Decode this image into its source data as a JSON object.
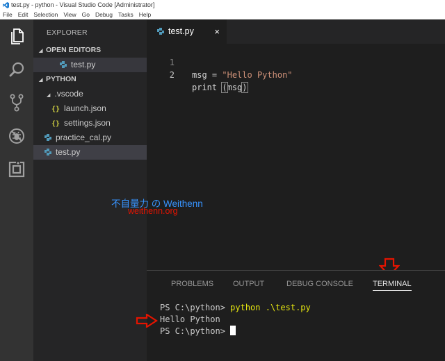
{
  "window": {
    "title": "test.py - python - Visual Studio Code [Administrator]"
  },
  "menu": [
    "File",
    "Edit",
    "Selection",
    "View",
    "Go",
    "Debug",
    "Tasks",
    "Help"
  ],
  "activity_bar": {
    "icons": [
      "files-icon",
      "search-icon",
      "source-control-icon",
      "debug-icon",
      "extensions-icon"
    ]
  },
  "sidebar": {
    "title": "EXPLORER",
    "open_editors": {
      "header": "OPEN EDITORS",
      "items": [
        {
          "label": "test.py"
        }
      ]
    },
    "folder": {
      "header": "PYTHON",
      "vscode": ".vscode",
      "launch": "launch.json",
      "settings": "settings.json",
      "practice": "practice_cal.py",
      "test": "test.py"
    }
  },
  "editor": {
    "tab_label": "test.py",
    "close_glyph": "×",
    "lines": [
      {
        "num": "1",
        "var": "msg",
        "op": " = ",
        "str": "\"Hello Python\""
      },
      {
        "num": "2",
        "fn": "print",
        "sp": " ",
        "lp": "(",
        "arg": "msg",
        "rp": ")"
      }
    ]
  },
  "watermark": {
    "line1": "不自量力 の Weithenn",
    "line2": "weithenn.org"
  },
  "panel": {
    "tabs": [
      "PROBLEMS",
      "OUTPUT",
      "DEBUG CONSOLE",
      "TERMINAL"
    ],
    "active_tab": "TERMINAL",
    "terminal": {
      "prompt1": "PS C:\\python> ",
      "cmd1": "python .\\test.py",
      "output": "Hello Python",
      "prompt2": "PS C:\\python> "
    }
  },
  "colors": {
    "accent_arrow": "#e51400",
    "watermark_blue": "#3794ff",
    "python_icon": "#519aba",
    "json_icon": "#cbcb41"
  }
}
